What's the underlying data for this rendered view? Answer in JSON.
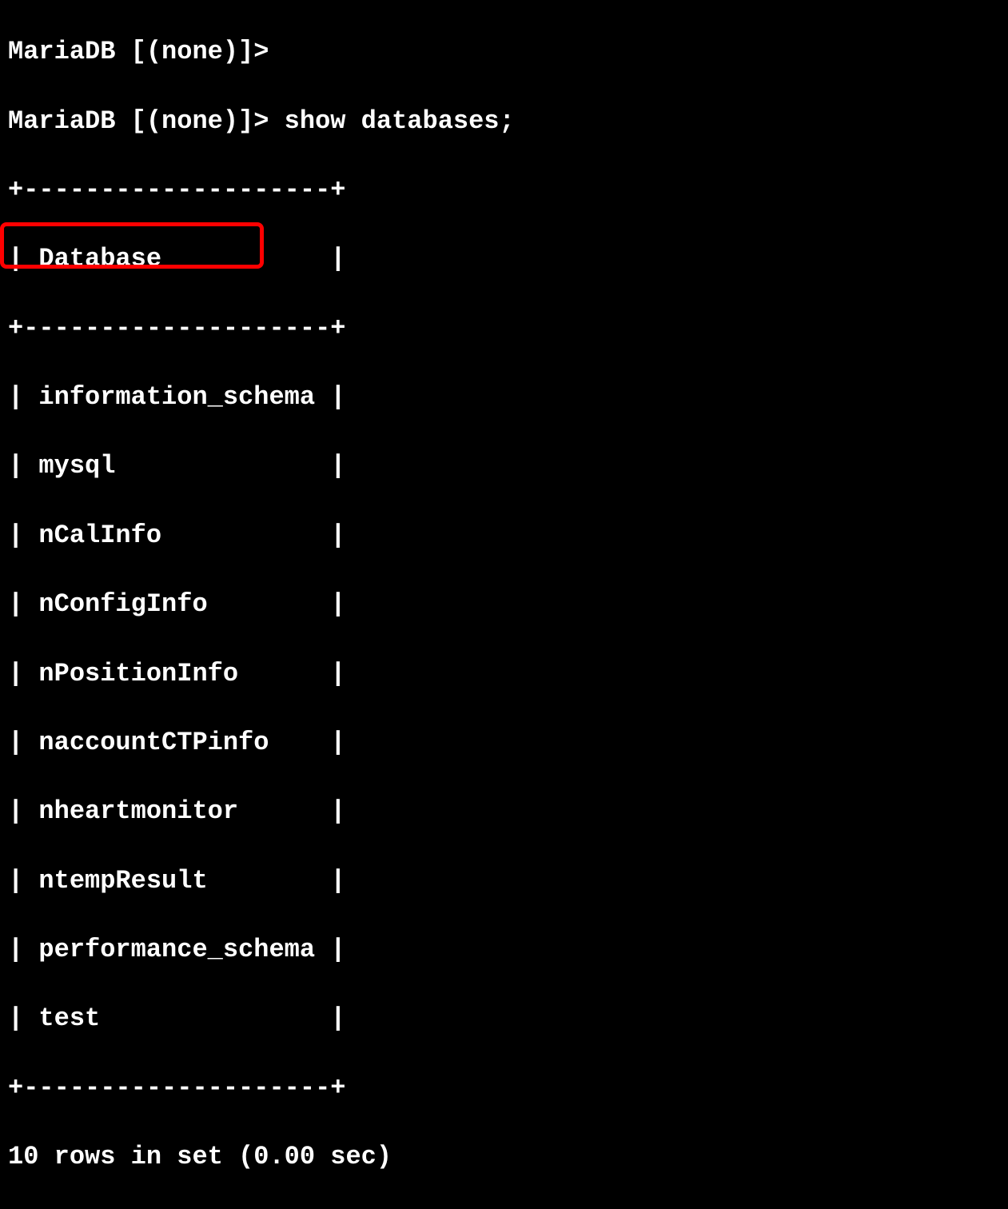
{
  "prompt1": "MariaDB [(none)]>",
  "prompt2": "MariaDB [(none)]> show databases;",
  "table_border": "+--------------------+",
  "table_header": "| Database           |",
  "rows": {
    "r0": "| information_schema |",
    "r1": "| mysql              |",
    "r2": "| nCalInfo           |",
    "r3": "| nConfigInfo        |",
    "r4": "| nPositionInfo      |",
    "r5": "| naccountCTPinfo    |",
    "r6": "| nheartmonitor      |",
    "r7": "| ntempResult        |",
    "r8": "| performance_schema |",
    "r9": "| test               |"
  },
  "result_summary": "10 rows in set (0.00 sec)"
}
